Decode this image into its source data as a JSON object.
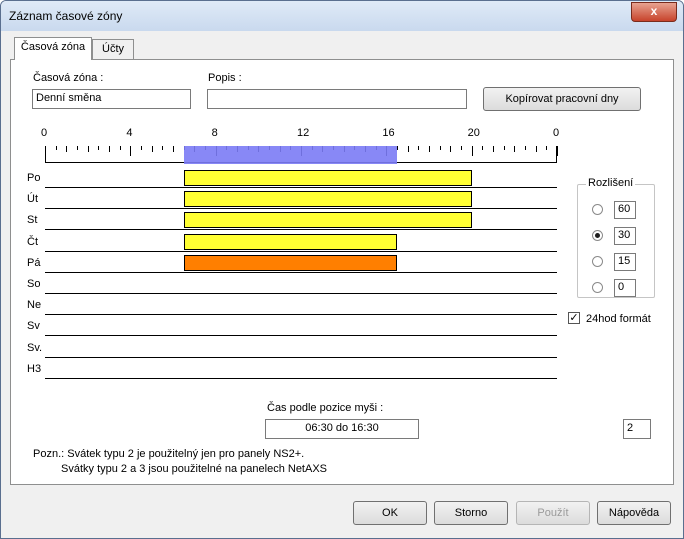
{
  "window": {
    "title": "Záznam časové zóny",
    "close_label": "x"
  },
  "tabs": [
    {
      "label": "Časová zóna"
    },
    {
      "label": "Účty"
    }
  ],
  "form": {
    "zone_label": "Časová zóna :",
    "zone_value": "Denní směna",
    "desc_label": "Popis :",
    "desc_value": "",
    "copy_button": "Kopírovat pracovní dny"
  },
  "timeline": {
    "tick_labels": [
      "0",
      "4",
      "8",
      "12",
      "16",
      "20",
      "0"
    ],
    "selection": {
      "start_hour": 6.5,
      "end_hour": 16.5,
      "color": "#7b7bf5"
    },
    "days": [
      {
        "label": "Po",
        "start": 6.5,
        "end": 20.0,
        "color": "#ffff33"
      },
      {
        "label": "Út",
        "start": 6.5,
        "end": 20.0,
        "color": "#ffff33"
      },
      {
        "label": "St",
        "start": 6.5,
        "end": 20.0,
        "color": "#ffff33"
      },
      {
        "label": "Čt",
        "start": 6.5,
        "end": 16.5,
        "color": "#ffff33"
      },
      {
        "label": "Pá",
        "start": 6.5,
        "end": 16.5,
        "color": "#ff7f00"
      },
      {
        "label": "So",
        "start": null,
        "end": null,
        "color": ""
      },
      {
        "label": "Ne",
        "start": null,
        "end": null,
        "color": ""
      },
      {
        "label": "Sv",
        "start": null,
        "end": null,
        "color": ""
      },
      {
        "label": "Sv.",
        "start": null,
        "end": null,
        "color": ""
      },
      {
        "label": "H3",
        "start": null,
        "end": null,
        "color": ""
      }
    ]
  },
  "resolution": {
    "label": "Rozlišení",
    "options": [
      {
        "value": "60",
        "selected": false
      },
      {
        "value": "30",
        "selected": true
      },
      {
        "value": "15",
        "selected": false
      },
      {
        "value": "0",
        "selected": false
      }
    ]
  },
  "format24": {
    "label": "24hod formát",
    "checked": true,
    "mark": "✓"
  },
  "mouse": {
    "label": "Čas podle pozice myši :",
    "value": "06:30 do 16:30",
    "counter": "2"
  },
  "notes": {
    "line1": "Pozn.: Svátek typu 2 je použitelný jen pro panely NS2+.",
    "line2": "Svátky typu 2 a 3 jsou použitelné na panelech NetAXS"
  },
  "buttons": {
    "ok": "OK",
    "cancel": "Storno",
    "apply": "Použít",
    "help": "Nápověda"
  }
}
